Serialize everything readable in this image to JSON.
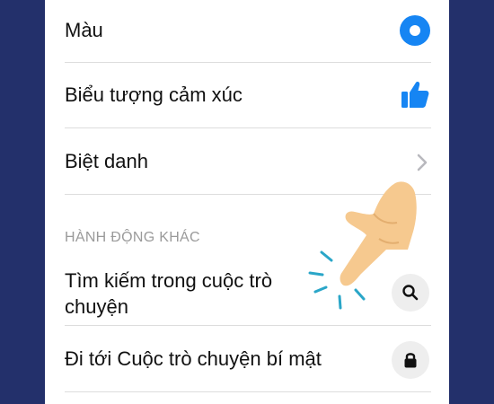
{
  "settings": {
    "rows": [
      {
        "label": "Màu",
        "icon": "color-dot-icon",
        "accent": "#1685f3"
      },
      {
        "label": "Biểu tượng cảm xúc",
        "icon": "thumbs-up-icon",
        "accent": "#1685f3"
      },
      {
        "label": "Biệt danh",
        "icon": "chevron-right-icon"
      }
    ],
    "section_header": "HÀNH ĐỘNG KHÁC",
    "actions": [
      {
        "label_line1": "Tìm kiếm trong cuộc trò",
        "label_line2": "chuyện",
        "icon": "search-icon"
      },
      {
        "label": "Đi tới Cuộc trò chuyện bí mật",
        "icon": "lock-icon"
      }
    ]
  },
  "overlay": {
    "icon": "tap-hand-icon",
    "skin_color": "#f6c98f",
    "tap_marks_color": "#2aa6c8"
  }
}
